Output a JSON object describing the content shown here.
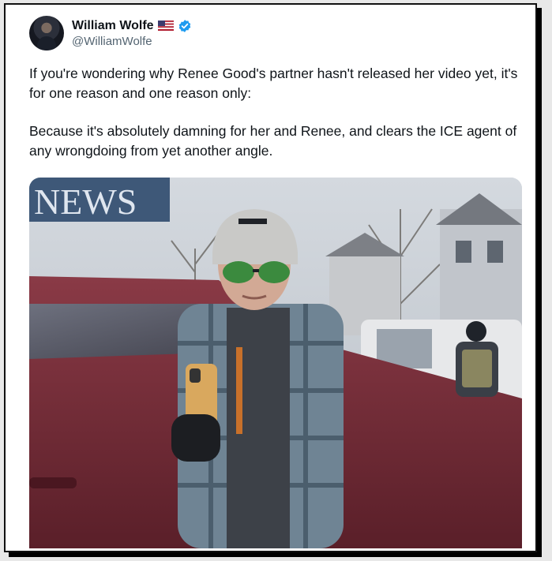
{
  "author": {
    "display_name": "William Wolfe",
    "handle": "@WilliamWolfe",
    "flag_emoji": "🇺🇸",
    "verified": true
  },
  "tweet": {
    "paragraphs": [
      "If you're wondering why Renee Good's partner hasn't released her video yet, it's for one reason and one reason only:",
      "Because it's absolutely damning for her and Renee, and clears the ICE agent of any wrongdoing from yet another angle."
    ]
  },
  "media": {
    "sign_text": "NEWS"
  },
  "colors": {
    "verified_blue": "#1d9bf0",
    "text_primary": "#0f1419",
    "text_secondary": "#536471",
    "car_maroon": "#6e2a34"
  }
}
